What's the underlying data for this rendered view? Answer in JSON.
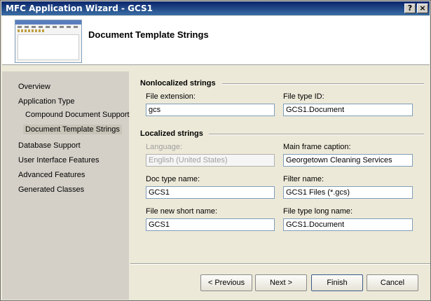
{
  "window": {
    "title": "MFC Application Wizard - GCS1",
    "help_label": "?",
    "close_label": "×"
  },
  "header": {
    "heading": "Document Template Strings"
  },
  "sidebar": {
    "items": [
      {
        "label": "Overview"
      },
      {
        "label": "Application Type"
      },
      {
        "label": "Compound Document Support"
      },
      {
        "label": "Document Template Strings"
      },
      {
        "label": "Database Support"
      },
      {
        "label": "User Interface Features"
      },
      {
        "label": "Advanced Features"
      },
      {
        "label": "Generated Classes"
      }
    ]
  },
  "nonlocalized": {
    "title": "Nonlocalized strings",
    "file_extension": {
      "label": "File extension:",
      "value": "gcs"
    },
    "file_type_id": {
      "label": "File type ID:",
      "value": "GCS1.Document"
    }
  },
  "localized": {
    "title": "Localized strings",
    "language": {
      "label": "Language:",
      "value": "English (United States)"
    },
    "main_frame_caption": {
      "label": "Main frame caption:",
      "value": "Georgetown Cleaning Services"
    },
    "doc_type_name": {
      "label": "Doc type name:",
      "value": "GCS1"
    },
    "filter_name": {
      "label": "Filter name:",
      "value": "GCS1 Files (*.gcs)"
    },
    "file_new_short_name": {
      "label": "File new short name:",
      "value": "GCS1"
    },
    "file_type_long_name": {
      "label": "File type long name:",
      "value": "GCS1.Document"
    }
  },
  "buttons": {
    "previous": "< Previous",
    "next": "Next >",
    "finish": "Finish",
    "cancel": "Cancel"
  }
}
